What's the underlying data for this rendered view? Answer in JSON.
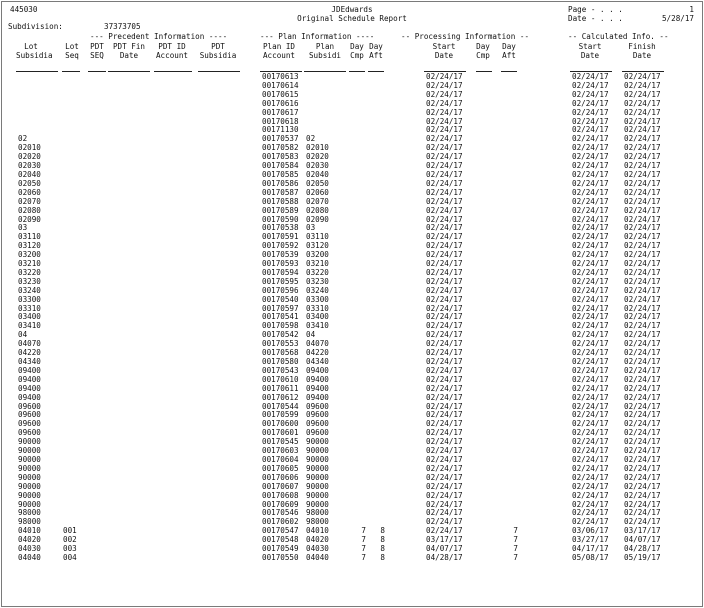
{
  "header": {
    "report_no": "445030",
    "company": "JDEdwards",
    "title": "Original Schedule Report",
    "page_label": "Page - . . .",
    "page_value": "1",
    "date_label": "Date - . . .",
    "date_value": "5/28/17",
    "subdivision_label": "Subdivision:",
    "subdivision_value": "37373705"
  },
  "groups": {
    "precedent": "--- Precedent Information ----",
    "plan": "--- Plan Information ----",
    "processing": "-- Processing Information --",
    "calculated": "-- Calculated Info. --"
  },
  "columns": {
    "lot_subsidia": [
      "Lot",
      "Subsidia"
    ],
    "lot_seq": [
      "Lot",
      "Seq"
    ],
    "pdt_seq": [
      "PDT",
      "SEQ"
    ],
    "pdt_fin_date": [
      "PDT Fin",
      "Date"
    ],
    "pdt_id_account": [
      "PDT ID",
      "Account"
    ],
    "pdt_subsidia": [
      "PDT",
      "Subsidia"
    ],
    "plan_id_account": [
      "Plan ID",
      "Account"
    ],
    "plan_subsidi": [
      "Plan",
      "Subsidi"
    ],
    "day_cmp": [
      "Day",
      "Cmp"
    ],
    "day_aft": [
      "Day",
      "Aft"
    ],
    "start_date": [
      "Start",
      "Date"
    ],
    "proc_day_cmp": [
      "Day",
      "Cmp"
    ],
    "proc_day_aft": [
      "Day",
      "Aft"
    ],
    "calc_start_date": [
      "Start",
      "Date"
    ],
    "finish_date": [
      "Finish",
      "Date"
    ]
  },
  "rows": [
    [
      "",
      "",
      "00170613",
      "",
      "",
      "",
      "02/24/17",
      "",
      "02/24/17",
      "02/24/17"
    ],
    [
      "",
      "",
      "00170614",
      "",
      "",
      "",
      "02/24/17",
      "",
      "02/24/17",
      "02/24/17"
    ],
    [
      "",
      "",
      "00170615",
      "",
      "",
      "",
      "02/24/17",
      "",
      "02/24/17",
      "02/24/17"
    ],
    [
      "",
      "",
      "00170616",
      "",
      "",
      "",
      "02/24/17",
      "",
      "02/24/17",
      "02/24/17"
    ],
    [
      "",
      "",
      "00170617",
      "",
      "",
      "",
      "02/24/17",
      "",
      "02/24/17",
      "02/24/17"
    ],
    [
      "",
      "",
      "00170618",
      "",
      "",
      "",
      "02/24/17",
      "",
      "02/24/17",
      "02/24/17"
    ],
    [
      "",
      "",
      "00171130",
      "",
      "",
      "",
      "02/24/17",
      "",
      "02/24/17",
      "02/24/17"
    ],
    [
      "02",
      "",
      "00170537",
      "02",
      "",
      "",
      "02/24/17",
      "",
      "02/24/17",
      "02/24/17"
    ],
    [
      "02010",
      "",
      "00170582",
      "02010",
      "",
      "",
      "02/24/17",
      "",
      "02/24/17",
      "02/24/17"
    ],
    [
      "02020",
      "",
      "00170583",
      "02020",
      "",
      "",
      "02/24/17",
      "",
      "02/24/17",
      "02/24/17"
    ],
    [
      "02030",
      "",
      "00170584",
      "02030",
      "",
      "",
      "02/24/17",
      "",
      "02/24/17",
      "02/24/17"
    ],
    [
      "02040",
      "",
      "00170585",
      "02040",
      "",
      "",
      "02/24/17",
      "",
      "02/24/17",
      "02/24/17"
    ],
    [
      "02050",
      "",
      "00170586",
      "02050",
      "",
      "",
      "02/24/17",
      "",
      "02/24/17",
      "02/24/17"
    ],
    [
      "02060",
      "",
      "00170587",
      "02060",
      "",
      "",
      "02/24/17",
      "",
      "02/24/17",
      "02/24/17"
    ],
    [
      "02070",
      "",
      "00170588",
      "02070",
      "",
      "",
      "02/24/17",
      "",
      "02/24/17",
      "02/24/17"
    ],
    [
      "02080",
      "",
      "00170589",
      "02080",
      "",
      "",
      "02/24/17",
      "",
      "02/24/17",
      "02/24/17"
    ],
    [
      "02090",
      "",
      "00170590",
      "02090",
      "",
      "",
      "02/24/17",
      "",
      "02/24/17",
      "02/24/17"
    ],
    [
      "03",
      "",
      "00170538",
      "03",
      "",
      "",
      "02/24/17",
      "",
      "02/24/17",
      "02/24/17"
    ],
    [
      "03110",
      "",
      "00170591",
      "03110",
      "",
      "",
      "02/24/17",
      "",
      "02/24/17",
      "02/24/17"
    ],
    [
      "03120",
      "",
      "00170592",
      "03120",
      "",
      "",
      "02/24/17",
      "",
      "02/24/17",
      "02/24/17"
    ],
    [
      "03200",
      "",
      "00170539",
      "03200",
      "",
      "",
      "02/24/17",
      "",
      "02/24/17",
      "02/24/17"
    ],
    [
      "03210",
      "",
      "00170593",
      "03210",
      "",
      "",
      "02/24/17",
      "",
      "02/24/17",
      "02/24/17"
    ],
    [
      "03220",
      "",
      "00170594",
      "03220",
      "",
      "",
      "02/24/17",
      "",
      "02/24/17",
      "02/24/17"
    ],
    [
      "03230",
      "",
      "00170595",
      "03230",
      "",
      "",
      "02/24/17",
      "",
      "02/24/17",
      "02/24/17"
    ],
    [
      "03240",
      "",
      "00170596",
      "03240",
      "",
      "",
      "02/24/17",
      "",
      "02/24/17",
      "02/24/17"
    ],
    [
      "03300",
      "",
      "00170540",
      "03300",
      "",
      "",
      "02/24/17",
      "",
      "02/24/17",
      "02/24/17"
    ],
    [
      "03310",
      "",
      "00170597",
      "03310",
      "",
      "",
      "02/24/17",
      "",
      "02/24/17",
      "02/24/17"
    ],
    [
      "03400",
      "",
      "00170541",
      "03400",
      "",
      "",
      "02/24/17",
      "",
      "02/24/17",
      "02/24/17"
    ],
    [
      "03410",
      "",
      "00170598",
      "03410",
      "",
      "",
      "02/24/17",
      "",
      "02/24/17",
      "02/24/17"
    ],
    [
      "04",
      "",
      "00170542",
      "04",
      "",
      "",
      "02/24/17",
      "",
      "02/24/17",
      "02/24/17"
    ],
    [
      "04070",
      "",
      "00170553",
      "04070",
      "",
      "",
      "02/24/17",
      "",
      "02/24/17",
      "02/24/17"
    ],
    [
      "04220",
      "",
      "00170568",
      "04220",
      "",
      "",
      "02/24/17",
      "",
      "02/24/17",
      "02/24/17"
    ],
    [
      "04340",
      "",
      "00170580",
      "04340",
      "",
      "",
      "02/24/17",
      "",
      "02/24/17",
      "02/24/17"
    ],
    [
      "09400",
      "",
      "00170543",
      "09400",
      "",
      "",
      "02/24/17",
      "",
      "02/24/17",
      "02/24/17"
    ],
    [
      "09400",
      "",
      "00170610",
      "09400",
      "",
      "",
      "02/24/17",
      "",
      "02/24/17",
      "02/24/17"
    ],
    [
      "09400",
      "",
      "00170611",
      "09400",
      "",
      "",
      "02/24/17",
      "",
      "02/24/17",
      "02/24/17"
    ],
    [
      "09400",
      "",
      "00170612",
      "09400",
      "",
      "",
      "02/24/17",
      "",
      "02/24/17",
      "02/24/17"
    ],
    [
      "09600",
      "",
      "00170544",
      "09600",
      "",
      "",
      "02/24/17",
      "",
      "02/24/17",
      "02/24/17"
    ],
    [
      "09600",
      "",
      "00170599",
      "09600",
      "",
      "",
      "02/24/17",
      "",
      "02/24/17",
      "02/24/17"
    ],
    [
      "09600",
      "",
      "00170600",
      "09600",
      "",
      "",
      "02/24/17",
      "",
      "02/24/17",
      "02/24/17"
    ],
    [
      "09600",
      "",
      "00170601",
      "09600",
      "",
      "",
      "02/24/17",
      "",
      "02/24/17",
      "02/24/17"
    ],
    [
      "90000",
      "",
      "00170545",
      "90000",
      "",
      "",
      "02/24/17",
      "",
      "02/24/17",
      "02/24/17"
    ],
    [
      "90000",
      "",
      "00170603",
      "90000",
      "",
      "",
      "02/24/17",
      "",
      "02/24/17",
      "02/24/17"
    ],
    [
      "90000",
      "",
      "00170604",
      "90000",
      "",
      "",
      "02/24/17",
      "",
      "02/24/17",
      "02/24/17"
    ],
    [
      "90000",
      "",
      "00170605",
      "90000",
      "",
      "",
      "02/24/17",
      "",
      "02/24/17",
      "02/24/17"
    ],
    [
      "90000",
      "",
      "00170606",
      "90000",
      "",
      "",
      "02/24/17",
      "",
      "02/24/17",
      "02/24/17"
    ],
    [
      "90000",
      "",
      "00170607",
      "90000",
      "",
      "",
      "02/24/17",
      "",
      "02/24/17",
      "02/24/17"
    ],
    [
      "90000",
      "",
      "00170608",
      "90000",
      "",
      "",
      "02/24/17",
      "",
      "02/24/17",
      "02/24/17"
    ],
    [
      "90000",
      "",
      "00170609",
      "90000",
      "",
      "",
      "02/24/17",
      "",
      "02/24/17",
      "02/24/17"
    ],
    [
      "98000",
      "",
      "00170546",
      "98000",
      "",
      "",
      "02/24/17",
      "",
      "02/24/17",
      "02/24/17"
    ],
    [
      "98000",
      "",
      "00170602",
      "98000",
      "",
      "",
      "02/24/17",
      "",
      "02/24/17",
      "02/24/17"
    ],
    [
      "04010",
      "001",
      "00170547",
      "04010",
      "7",
      "8",
      "02/24/17",
      "7",
      "03/06/17",
      "03/17/17"
    ],
    [
      "04020",
      "002",
      "00170548",
      "04020",
      "7",
      "8",
      "03/17/17",
      "7",
      "03/27/17",
      "04/07/17"
    ],
    [
      "04030",
      "003",
      "00170549",
      "04030",
      "7",
      "8",
      "04/07/17",
      "7",
      "04/17/17",
      "04/28/17"
    ],
    [
      "04040",
      "004",
      "00170550",
      "04040",
      "7",
      "8",
      "04/28/17",
      "7",
      "05/08/17",
      "05/19/17"
    ]
  ]
}
